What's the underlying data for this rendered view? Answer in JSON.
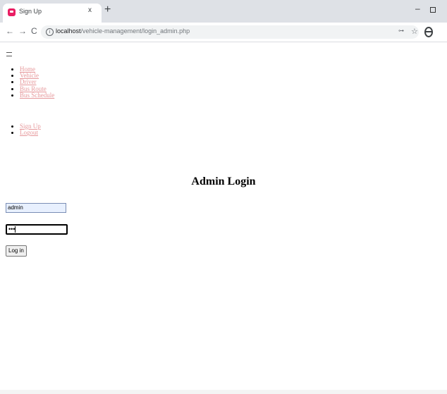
{
  "browser": {
    "tab_title": "Sign Up",
    "tab_close": "x",
    "new_tab": "+",
    "url_host": "localhost",
    "url_path": "/vehicle-management/login_admin.php",
    "back": "←",
    "forward": "→",
    "reload": "C",
    "window_min": "–"
  },
  "nav": {
    "main_items": [
      "Home",
      "Vehicle",
      "Driver",
      "Bus Route",
      "Bus Schedule"
    ],
    "user_items": [
      "Sign Up",
      "Logout"
    ]
  },
  "login": {
    "title": "Admin Login",
    "username_value": "admin",
    "password_value": "•••",
    "submit_label": "Log in"
  },
  "colors": {
    "link": "#e6989b",
    "autofill": "#e8f0fe"
  }
}
